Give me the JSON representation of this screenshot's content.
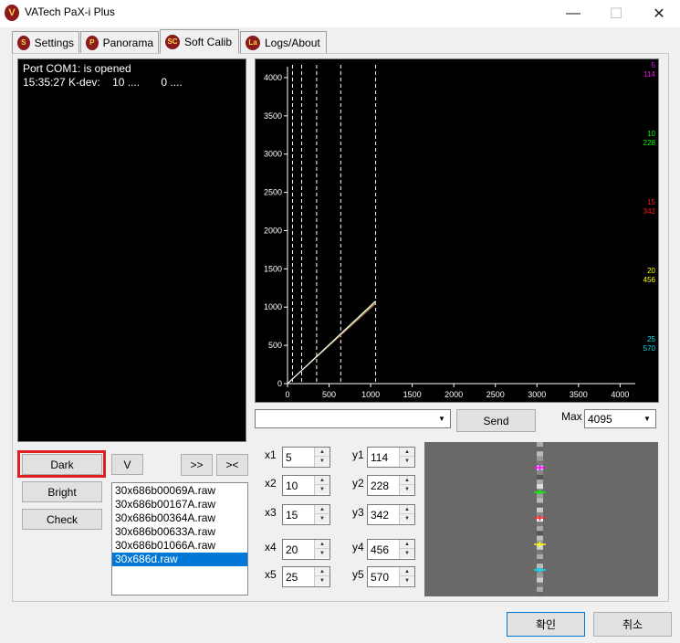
{
  "window": {
    "title": "VATech PaX-i Plus",
    "icon_letter": "V",
    "minimize_glyph": "—",
    "maximize_glyph": "☐",
    "close_glyph": "✕"
  },
  "tabs": [
    {
      "label": "Settings",
      "icon_text": "S"
    },
    {
      "label": "Panorama",
      "icon_text": "P"
    },
    {
      "label": "Soft Calib",
      "icon_text": "SC",
      "active": true
    },
    {
      "label": "Logs/About",
      "icon_text": "La"
    }
  ],
  "log": {
    "lines": [
      "Port COM1: is opened",
      "15:35:27 K-dev:    10 ....       0 ...."
    ]
  },
  "graph": {
    "x_ticks": [
      "0",
      "500",
      "1000",
      "1500",
      "2000",
      "2500",
      "3000",
      "3500",
      "4000"
    ],
    "y_ticks": [
      "0",
      "500",
      "1000",
      "1500",
      "2000",
      "2500",
      "3000",
      "3500",
      "4000"
    ],
    "x_range": [
      0,
      4095
    ],
    "y_range": [
      0,
      4095
    ],
    "series_labels": [
      {
        "top": "5",
        "bottom": "114",
        "color": "#ff00ff"
      },
      {
        "top": "10",
        "bottom": "228",
        "color": "#00ff00"
      },
      {
        "top": "15",
        "bottom": "342",
        "color": "#ff2020"
      },
      {
        "top": "20",
        "bottom": "456",
        "color": "#ffff00"
      },
      {
        "top": "25",
        "bottom": "570",
        "color": "#00e5ff"
      }
    ],
    "vlines_x": [
      60,
      170,
      350,
      640,
      1060
    ],
    "line_end": [
      1060,
      1060
    ]
  },
  "controls": {
    "send_label": "Send",
    "max_label": "Max",
    "max_value": "4095",
    "command_value": ""
  },
  "buttons": {
    "dark": "Dark",
    "bright": "Bright",
    "check": "Check",
    "v": "V",
    "next": ">>",
    "prev": "><",
    "ok": "확인",
    "cancel": "취소"
  },
  "files": [
    {
      "name": "30x686b00069A.raw",
      "selected": false
    },
    {
      "name": "30x686b00167A.raw",
      "selected": false
    },
    {
      "name": "30x686b00364A.raw",
      "selected": false
    },
    {
      "name": "30x686b00633A.raw",
      "selected": false
    },
    {
      "name": "30x686b01066A.raw",
      "selected": false
    },
    {
      "name": "30x686d.raw",
      "selected": true
    }
  ],
  "spinners": {
    "x": [
      {
        "label": "x1",
        "value": "5"
      },
      {
        "label": "x2",
        "value": "10"
      },
      {
        "label": "x3",
        "value": "15"
      },
      {
        "label": "x4",
        "value": "20"
      },
      {
        "label": "x5",
        "value": "25"
      }
    ],
    "y": [
      {
        "label": "y1",
        "value": "114"
      },
      {
        "label": "y2",
        "value": "228"
      },
      {
        "label": "y3",
        "value": "342"
      },
      {
        "label": "y4",
        "value": "456"
      },
      {
        "label": "y5",
        "value": "570"
      }
    ]
  },
  "preview": {
    "marker_colors": [
      "#ff00ff",
      "#00ff00",
      "#ff2020",
      "#ffff00",
      "#00e5ff"
    ]
  }
}
